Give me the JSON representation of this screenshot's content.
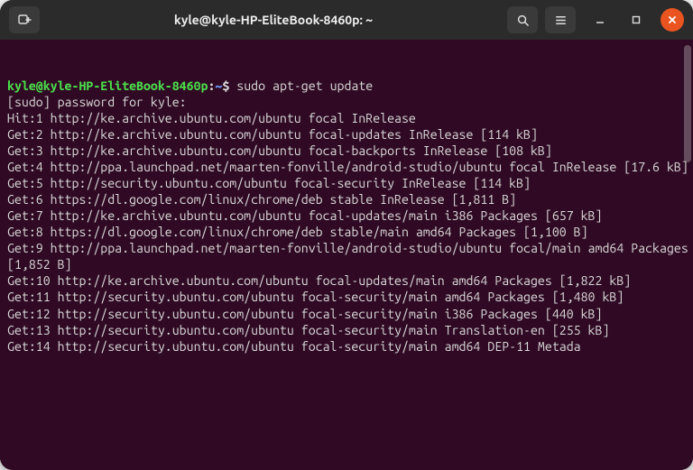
{
  "window": {
    "title": "kyle@kyle-HP-EliteBook-8460p: ~"
  },
  "prompt": {
    "user_host": "kyle@kyle-HP-EliteBook-8460p",
    "path": "~",
    "symbol": "$",
    "command": "sudo apt-get update"
  },
  "output_lines": [
    "[sudo] password for kyle:",
    "Hit:1 http://ke.archive.ubuntu.com/ubuntu focal InRelease",
    "Get:2 http://ke.archive.ubuntu.com/ubuntu focal-updates InRelease [114 kB]",
    "Get:3 http://ke.archive.ubuntu.com/ubuntu focal-backports InRelease [108 kB]",
    "Get:4 http://ppa.launchpad.net/maarten-fonville/android-studio/ubuntu focal InRelease [17.6 kB]",
    "Get:5 http://security.ubuntu.com/ubuntu focal-security InRelease [114 kB]",
    "Get:6 https://dl.google.com/linux/chrome/deb stable InRelease [1,811 B]",
    "Get:7 http://ke.archive.ubuntu.com/ubuntu focal-updates/main i386 Packages [657 kB]",
    "Get:8 https://dl.google.com/linux/chrome/deb stable/main amd64 Packages [1,100 B]",
    "Get:9 http://ppa.launchpad.net/maarten-fonville/android-studio/ubuntu focal/main amd64 Packages [1,852 B]",
    "Get:10 http://ke.archive.ubuntu.com/ubuntu focal-updates/main amd64 Packages [1,822 kB]",
    "Get:11 http://security.ubuntu.com/ubuntu focal-security/main amd64 Packages [1,480 kB]",
    "Get:12 http://security.ubuntu.com/ubuntu focal-security/main i386 Packages [440 kB]",
    "Get:13 http://security.ubuntu.com/ubuntu focal-security/main Translation-en [255 kB]",
    "Get:14 http://security.ubuntu.com/ubuntu focal-security/main amd64 DEP-11 Metada"
  ]
}
